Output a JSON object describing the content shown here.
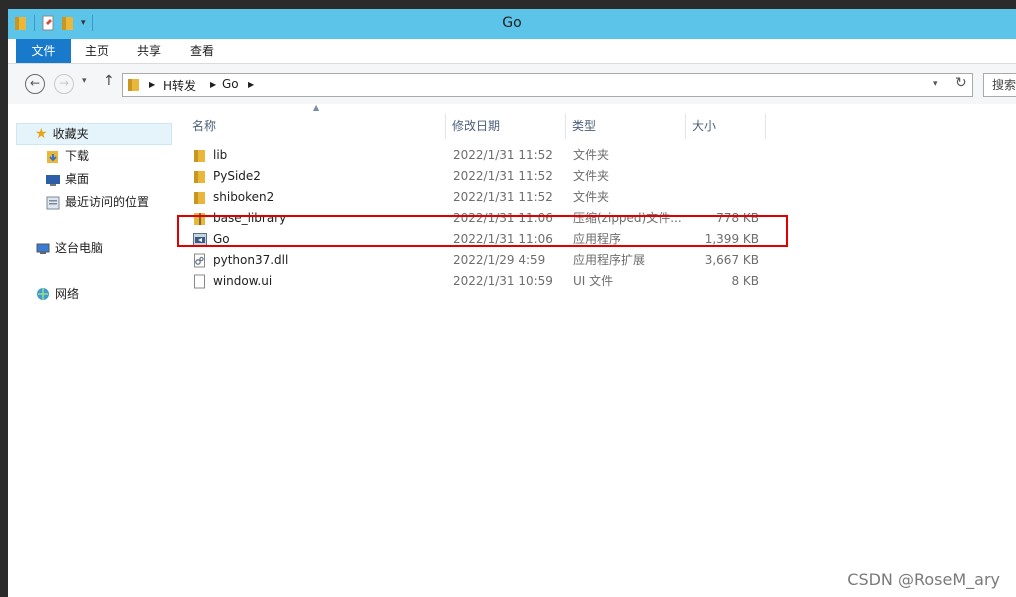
{
  "window": {
    "title": "Go"
  },
  "ribbon": {
    "tabs": [
      "文件",
      "主页",
      "共享",
      "查看"
    ]
  },
  "address": {
    "crumbs": [
      "H转发",
      "Go"
    ],
    "search_placeholder": "搜索"
  },
  "sidebar": {
    "favorites": "收藏夹",
    "items": [
      "下载",
      "桌面",
      "最近访问的位置"
    ],
    "computer": "这台电脑",
    "network": "网络"
  },
  "columns": [
    "名称",
    "修改日期",
    "类型",
    "大小"
  ],
  "files": [
    {
      "name": "lib",
      "date": "2022/1/31 11:52",
      "type": "文件夹",
      "size": "",
      "icon": "folder-icon"
    },
    {
      "name": "PySide2",
      "date": "2022/1/31 11:52",
      "type": "文件夹",
      "size": "",
      "icon": "folder-icon"
    },
    {
      "name": "shiboken2",
      "date": "2022/1/31 11:52",
      "type": "文件夹",
      "size": "",
      "icon": "folder-icon"
    },
    {
      "name": "base_library",
      "date": "2022/1/31 11:06",
      "type": "压缩(zipped)文件...",
      "size": "778 KB",
      "icon": "zip-icon"
    },
    {
      "name": "Go",
      "date": "2022/1/31 11:06",
      "type": "应用程序",
      "size": "1,399 KB",
      "icon": "exe-icon"
    },
    {
      "name": "python37.dll",
      "date": "2022/1/29 4:59",
      "type": "应用程序扩展",
      "size": "3,667 KB",
      "icon": "dll-icon"
    },
    {
      "name": "window.ui",
      "date": "2022/1/31 10:59",
      "type": "UI 文件",
      "size": "8 KB",
      "icon": "file-icon"
    }
  ],
  "watermark": "CSDN @RoseM_ary",
  "colors": {
    "titlebar": "#5bc4e8",
    "file_tab": "#1979ca",
    "highlight_box": "#e00000",
    "folder": "#e8b73c"
  }
}
